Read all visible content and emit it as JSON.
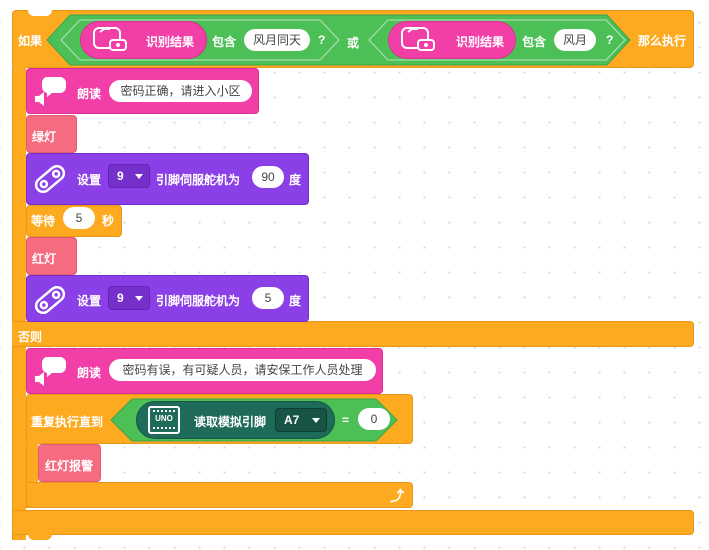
{
  "if_block": {
    "if_label": "如果",
    "then_label": "那么执行",
    "else_label": "否则",
    "or_label": "或",
    "condition_left": {
      "reporter": "识别结果",
      "contains": "包含",
      "value": "风月同天",
      "q": "?"
    },
    "condition_right": {
      "reporter": "识别结果",
      "contains": "包含",
      "value": "风月",
      "q": "?"
    }
  },
  "then_blocks": {
    "speak1": {
      "label": "朗读",
      "text": "密码正确，请进入小区"
    },
    "green_light": "绿灯",
    "servo1": {
      "set": "设置",
      "pin": "9",
      "mid": "引脚伺服舵机为",
      "angle": "90",
      "unit": "度"
    },
    "wait": {
      "label": "等待",
      "value": "5",
      "unit": "秒"
    },
    "red_light": "红灯",
    "servo2": {
      "set": "设置",
      "pin": "9",
      "mid": "引脚伺服舵机为",
      "angle": "5",
      "unit": "度"
    }
  },
  "else_blocks": {
    "speak2": {
      "label": "朗读",
      "text": "密码有误，有可疑人员，请安保工作人员处理"
    },
    "repeat": {
      "label": "重复执行直到",
      "read": "读取模拟引脚",
      "pin": "A7",
      "eq": "=",
      "value": "0",
      "uno": "UNO",
      "inner": "红灯报警"
    }
  },
  "colors": {
    "control": "#fdaa20",
    "operator": "#4cbf56",
    "speech": "#f23fa8",
    "light": "#f56c80",
    "servo": "#8b3fe6",
    "arduino": "#1e6b5a"
  }
}
